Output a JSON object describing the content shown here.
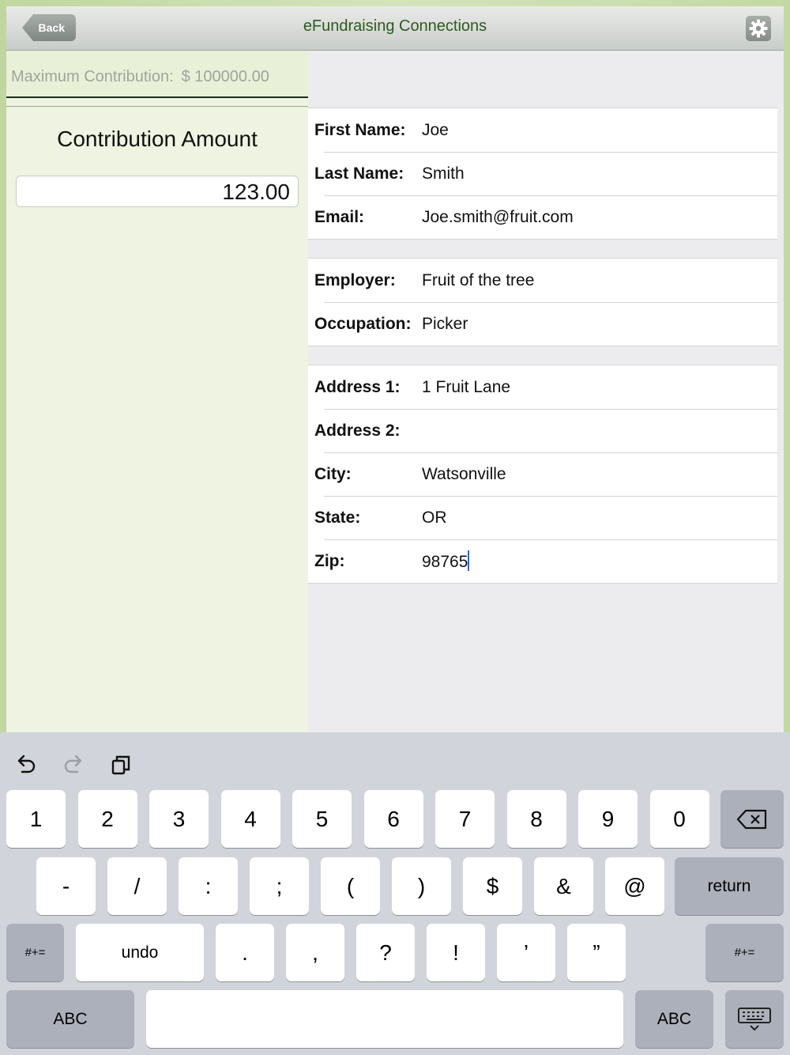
{
  "nav": {
    "back_label": "Back",
    "title": "eFundraising Connections",
    "settings_icon": "gear-icon"
  },
  "left": {
    "max_label": "Maximum Contribution:",
    "max_value": "$ 100000.00",
    "contribution_title": "Contribution Amount",
    "contribution_value": "123.00"
  },
  "form": {
    "contact": [
      {
        "label": "First Name:",
        "value": "Joe"
      },
      {
        "label": "Last Name:",
        "value": "Smith"
      },
      {
        "label": "Email:",
        "value": "Joe.smith@fruit.com"
      }
    ],
    "employment": [
      {
        "label": "Employer:",
        "value": "Fruit of the tree"
      },
      {
        "label": "Occupation:",
        "value": "Picker"
      }
    ],
    "address": [
      {
        "label": "Address 1:",
        "value": "1 Fruit Lane"
      },
      {
        "label": "Address 2:",
        "value": ""
      },
      {
        "label": "City:",
        "value": "Watsonville"
      },
      {
        "label": "State:",
        "value": "OR"
      },
      {
        "label": "Zip:",
        "value": "98765"
      }
    ]
  },
  "keyboard": {
    "toolbar": [
      "undo-arrow-icon",
      "redo-arrow-icon",
      "paste-icon"
    ],
    "row1": [
      "1",
      "2",
      "3",
      "4",
      "5",
      "6",
      "7",
      "8",
      "9",
      "0"
    ],
    "row2": [
      "-",
      "/",
      ":",
      ";",
      "(",
      ")",
      "$",
      "&",
      "@"
    ],
    "return_label": "return",
    "shift_label": "#+=",
    "undo_label": "undo",
    "row3": [
      ".",
      ",",
      "?",
      "!",
      "’",
      "”"
    ],
    "abc_label": "ABC",
    "space_label": "",
    "dismiss_icon": "keyboard-dismiss-icon"
  }
}
